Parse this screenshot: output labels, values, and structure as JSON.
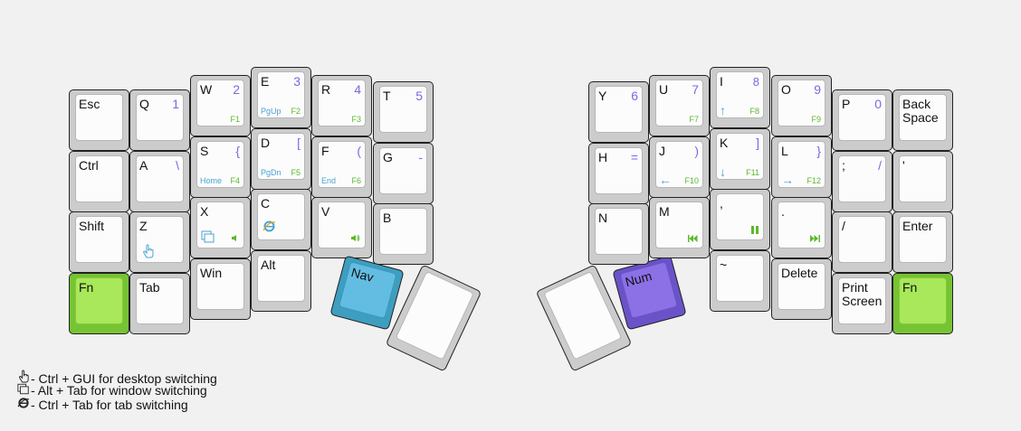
{
  "keys": {
    "esc": {
      "label": "Esc"
    },
    "q": {
      "label": "Q",
      "num": "1"
    },
    "w": {
      "label": "W",
      "num": "2",
      "fn": "F1"
    },
    "e": {
      "label": "E",
      "num": "3",
      "nav": "PgUp",
      "fn": "F2"
    },
    "r": {
      "label": "R",
      "num": "4",
      "fn": "F3"
    },
    "t": {
      "label": "T",
      "num": "5"
    },
    "ctrl": {
      "label": "Ctrl"
    },
    "a": {
      "label": "A",
      "sym": "\\"
    },
    "s": {
      "label": "S",
      "sym": "{",
      "nav": "Home",
      "fn": "F4"
    },
    "d": {
      "label": "D",
      "sym": "[",
      "nav": "PgDn",
      "fn": "F5"
    },
    "f": {
      "label": "F",
      "sym": "(",
      "nav": "End",
      "fn": "F6"
    },
    "g": {
      "label": "G",
      "sym": "-"
    },
    "shift": {
      "label": "Shift"
    },
    "z": {
      "label": "Z",
      "icon": "hand-icon"
    },
    "x": {
      "label": "X",
      "icon": "windows-icon",
      "media": "volume-down-icon"
    },
    "c": {
      "label": "C",
      "icon": "browser-icon"
    },
    "v": {
      "label": "V",
      "media": "volume-up-icon"
    },
    "b": {
      "label": "B"
    },
    "fn_left": {
      "label": "Fn"
    },
    "tab": {
      "label": "Tab"
    },
    "win": {
      "label": "Win"
    },
    "alt": {
      "label": "Alt"
    },
    "nav": {
      "label": "Nav"
    },
    "y": {
      "label": "Y",
      "num": "6"
    },
    "u": {
      "label": "U",
      "num": "7",
      "fn": "F7"
    },
    "i": {
      "label": "I",
      "num": "8",
      "arrow": "↑",
      "fn": "F8"
    },
    "o": {
      "label": "O",
      "num": "9",
      "fn": "F9"
    },
    "p": {
      "label": "P",
      "num": "0"
    },
    "backspace": {
      "label": "Back\nSpace"
    },
    "h": {
      "label": "H",
      "sym": "="
    },
    "j": {
      "label": "J",
      "sym": ")",
      "arrow": "←",
      "fn": "F10"
    },
    "k": {
      "label": "K",
      "sym": "]",
      "arrow": "↓",
      "fn": "F11"
    },
    "l": {
      "label": "L",
      "sym": "}",
      "arrow": "→",
      "fn": "F12"
    },
    "semicolon": {
      "label": ";",
      "sym": "/"
    },
    "quote": {
      "label": "'"
    },
    "n": {
      "label": "N"
    },
    "m": {
      "label": "M",
      "media": "previous-track-icon"
    },
    "comma": {
      "label": ",",
      "media": "play-pause-icon"
    },
    "period": {
      "label": ".",
      "media": "next-track-icon"
    },
    "slash": {
      "label": "/"
    },
    "enter": {
      "label": "Enter"
    },
    "tilde": {
      "label": "~"
    },
    "delete": {
      "label": "Delete"
    },
    "printscreen": {
      "label": "Print\nScreen"
    },
    "fn_right": {
      "label": "Fn"
    },
    "num": {
      "label": "Num"
    }
  },
  "legend": [
    {
      "icon": "hand-icon",
      "text": "- Ctrl + GUI for desktop switching"
    },
    {
      "icon": "windows-icon",
      "text": "- Alt + Tab for window switching"
    },
    {
      "icon": "browser-icon",
      "text": "- Ctrl + Tab for tab switching"
    }
  ],
  "colors": {
    "green": "#a8e85a",
    "nav_blue": "#63bde2",
    "num_purple": "#8b70e6",
    "fn_green": "#5cb82c",
    "num_purple_text": "#7a6ae0",
    "nav_text_blue": "#4aa3d4"
  }
}
